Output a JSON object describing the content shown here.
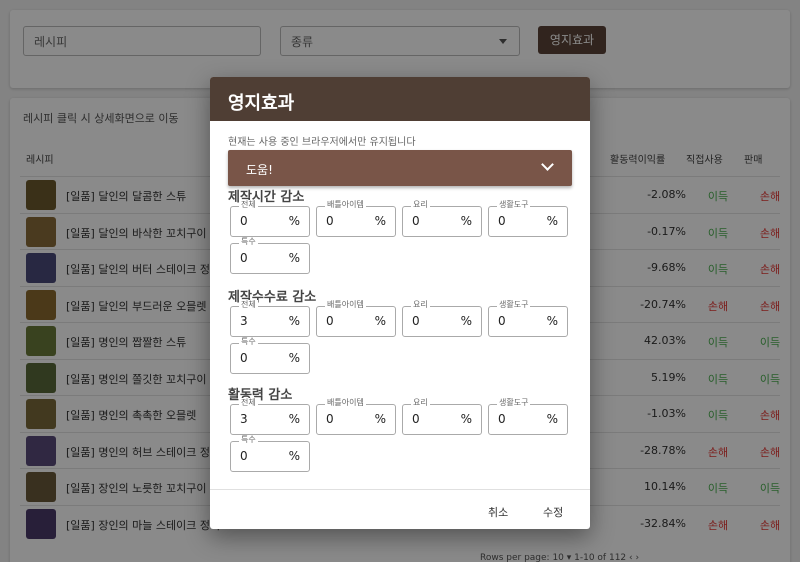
{
  "filters": {
    "recipe_placeholder": "레시피",
    "kind_placeholder": "종류",
    "effect_button": "영지효과"
  },
  "list": {
    "hint": "레시피 클릭 시 상세화면으로 이동",
    "columns": {
      "recipe": "레시피",
      "rate": "활동력이익률",
      "direct": "직접사용",
      "sell": "판매"
    },
    "rows": [
      {
        "name": "[일품] 달인의 달콤한 스튜",
        "rate": "-2.08%",
        "direct": "이득",
        "sell": "손해"
      },
      {
        "name": "[일품] 달인의 바삭한 꼬치구이",
        "rate": "-0.17%",
        "direct": "이득",
        "sell": "손해"
      },
      {
        "name": "[일품] 달인의 버터 스테이크 정식",
        "rate": "-9.68%",
        "direct": "이득",
        "sell": "손해"
      },
      {
        "name": "[일품] 달인의 부드러운 오믈렛",
        "rate": "-20.74%",
        "direct": "손해",
        "sell": "손해"
      },
      {
        "name": "[일품] 명인의 짭짤한 스튜",
        "rate": "42.03%",
        "direct": "이득",
        "sell": "이득"
      },
      {
        "name": "[일품] 명인의 쫄깃한 꼬치구이",
        "rate": "5.19%",
        "direct": "이득",
        "sell": "이득"
      },
      {
        "name": "[일품] 명인의 촉촉한 오믈렛",
        "rate": "-1.03%",
        "direct": "이득",
        "sell": "손해"
      },
      {
        "name": "[일품] 명인의 허브 스테이크 정식",
        "rate": "-28.78%",
        "direct": "손해",
        "sell": "손해"
      },
      {
        "name": "[일품] 장인의 노릇한 꼬치구이",
        "rate": "10.14%",
        "direct": "이득",
        "sell": "이득"
      },
      {
        "name": "[일품] 장인의 마늘 스테이크 정식",
        "rate": "-32.84%",
        "direct": "손해",
        "sell": "손해"
      }
    ],
    "pager": "Rows per page:   10   ▾      1-10 of 112     ‹     ›"
  },
  "dialog": {
    "title": "영지효과",
    "notice": "현재는 사용 중인 브라우저에서만 유지됩니다",
    "help": "도움!",
    "sections": [
      {
        "title": "제작시간 감소",
        "fields": [
          {
            "label": "전체",
            "value": "0",
            "unit": "%"
          },
          {
            "label": "배틀아이템",
            "value": "0",
            "unit": "%"
          },
          {
            "label": "요리",
            "value": "0",
            "unit": "%"
          },
          {
            "label": "생활도구",
            "value": "0",
            "unit": "%"
          },
          {
            "label": "특수",
            "value": "0",
            "unit": "%"
          }
        ]
      },
      {
        "title": "제작수수료 감소",
        "fields": [
          {
            "label": "전체",
            "value": "3",
            "unit": "%"
          },
          {
            "label": "배틀아이템",
            "value": "0",
            "unit": "%"
          },
          {
            "label": "요리",
            "value": "0",
            "unit": "%"
          },
          {
            "label": "생활도구",
            "value": "0",
            "unit": "%"
          },
          {
            "label": "특수",
            "value": "0",
            "unit": "%"
          }
        ]
      },
      {
        "title": "활동력 감소",
        "fields": [
          {
            "label": "전체",
            "value": "3",
            "unit": "%"
          },
          {
            "label": "배틀아이템",
            "value": "0",
            "unit": "%"
          },
          {
            "label": "요리",
            "value": "0",
            "unit": "%"
          },
          {
            "label": "생활도구",
            "value": "0",
            "unit": "%"
          },
          {
            "label": "특수",
            "value": "0",
            "unit": "%"
          }
        ]
      }
    ],
    "cancel": "취소",
    "confirm": "수정"
  },
  "colors": {
    "header_brown": "#4f3e34",
    "help_brown": "#795548",
    "gain": "#4caf50",
    "loss": "#e53935"
  }
}
